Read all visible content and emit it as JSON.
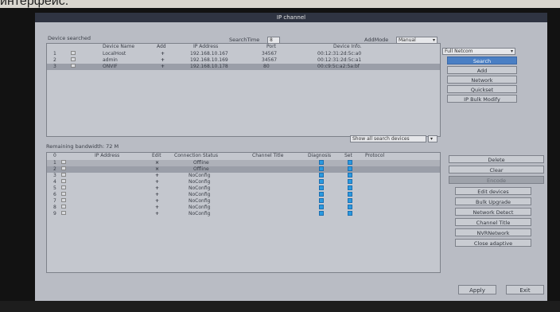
{
  "caption": "интерфейс.",
  "window": {
    "title": "IP channel"
  },
  "top": {
    "device_searched_label": "Device searched",
    "search_time_label": "SearchTime",
    "search_time_value": "8",
    "add_mode_label": "AddMode",
    "add_mode_value": "Manual",
    "columns": [
      "",
      "",
      "Device Name",
      "Add",
      "IP Address",
      "Port",
      "Device Info."
    ],
    "rows": [
      {
        "n": "1",
        "name": "LocalHost",
        "add": "+",
        "ip": "192.168.10.167",
        "port": "34567",
        "info": "00:12:31:2d:5c:a0"
      },
      {
        "n": "2",
        "name": "admin",
        "add": "+",
        "ip": "192.168.10.169",
        "port": "34567",
        "info": "00:12:31:2d:5c:a1"
      },
      {
        "n": "3",
        "name": "ONVIF",
        "add": "+",
        "ip": "192.168.10.178",
        "port": "80",
        "info": "00:c9:5c:a2:5a:bf"
      }
    ],
    "show_all_label": "Show all search devices",
    "protocol_select": "Full Netcom",
    "buttons": [
      "Search",
      "Add",
      "Network",
      "Quickset",
      "IP Bulk Modify"
    ]
  },
  "bottom": {
    "bandwidth_label": "Remaining bandwidth: 72 M",
    "columns": [
      "0",
      "",
      "IP Address",
      "Edit",
      "Connection Status",
      "Channel Title",
      "Diagnosis",
      "Set",
      "Protocol"
    ],
    "rows": [
      {
        "n": "1",
        "edit": "×",
        "status": "Offline"
      },
      {
        "n": "2",
        "edit": "×",
        "status": "Offline"
      },
      {
        "n": "3",
        "edit": "+",
        "status": "NoConfig"
      },
      {
        "n": "4",
        "edit": "+",
        "status": "NoConfig"
      },
      {
        "n": "5",
        "edit": "+",
        "status": "NoConfig"
      },
      {
        "n": "6",
        "edit": "+",
        "status": "NoConfig"
      },
      {
        "n": "7",
        "edit": "+",
        "status": "NoConfig"
      },
      {
        "n": "8",
        "edit": "+",
        "status": "NoConfig"
      },
      {
        "n": "9",
        "edit": "+",
        "status": "NoConfig"
      }
    ],
    "buttons": [
      "Delete",
      "Clear",
      "Encode",
      "Edit devices",
      "Bulk Upgrade",
      "Network Detect",
      "Channel Title",
      "NVRNetwork",
      "Close adaptive"
    ]
  },
  "footer": {
    "apply": "Apply",
    "exit": "Exit"
  }
}
